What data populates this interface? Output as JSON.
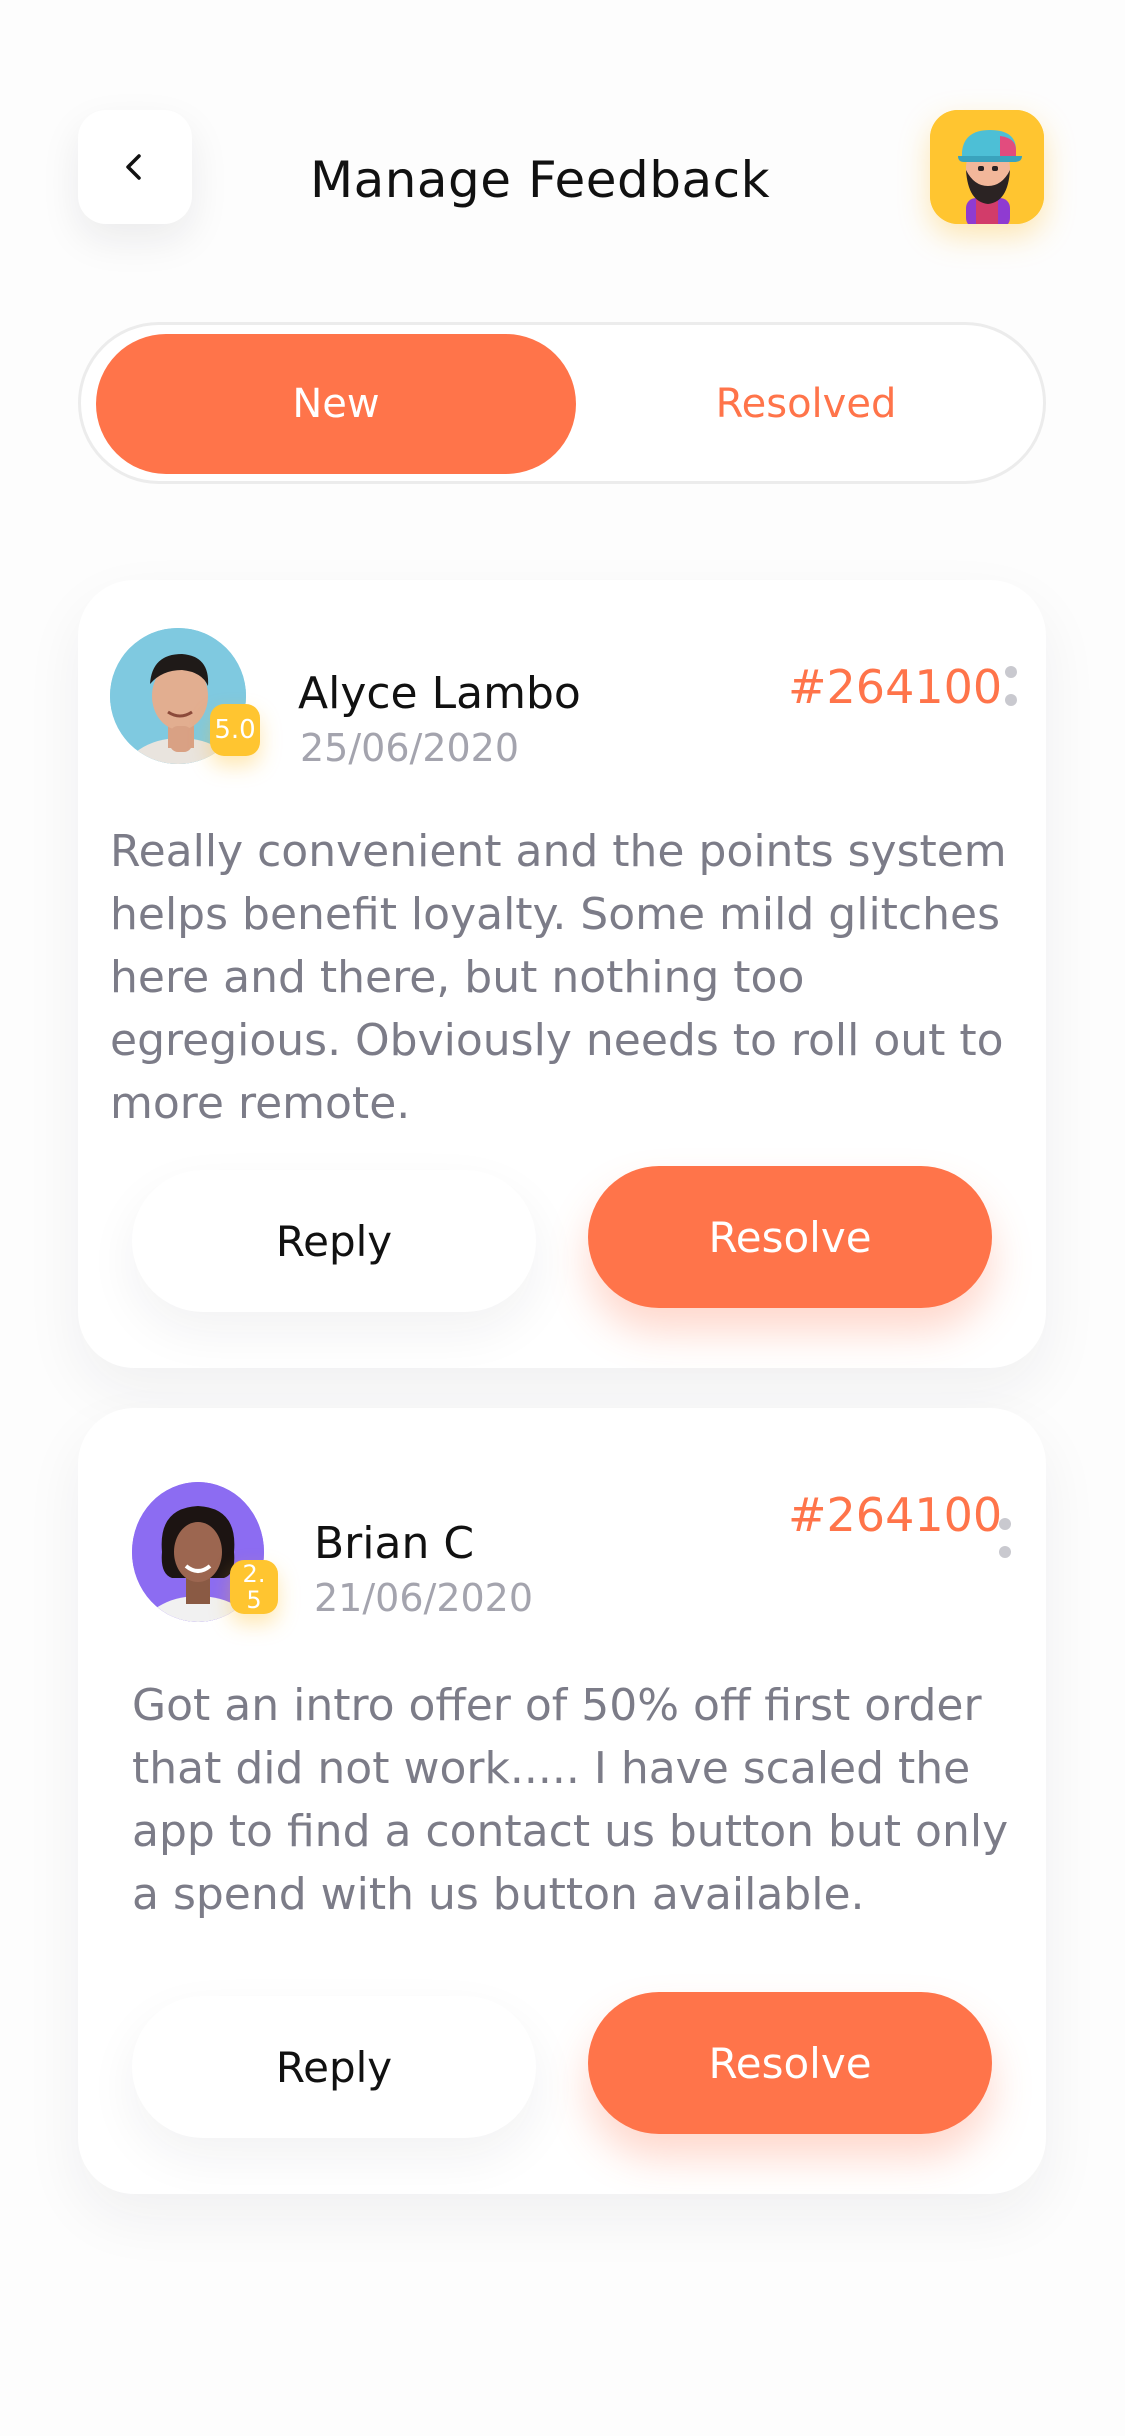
{
  "header": {
    "title": "Manage Feedback",
    "back_icon": "chevron-left-icon",
    "profile_avatar": "bearded-man-avatar"
  },
  "tabs": [
    {
      "label": "New",
      "active": true
    },
    {
      "label": "Resolved",
      "active": false
    }
  ],
  "feedback": [
    {
      "name": "Alyce Lambo",
      "date": "25/06/2020",
      "rating": "5.0",
      "ticket": "#264100",
      "comment": "Really convenient and the points system helps benefit loyalty. Some mild glitches here and there, but nothing too egregious. Obviously needs to roll out to more remote.",
      "reply_label": "Reply",
      "resolve_label": "Resolve"
    },
    {
      "name": "Brian C",
      "date": "21/06/2020",
      "rating": "2.5",
      "ticket": "#264100",
      "comment": "Got an intro offer of 50% off first order that did not work..... I have scaled the app to find a contact us button but only a spend with us button available.",
      "reply_label": "Reply",
      "resolve_label": "Resolve"
    }
  ],
  "colors": {
    "accent": "#ff744a",
    "badge": "#ffc530",
    "muted_text": "#7c7c88",
    "date_text": "#a4a4ae"
  }
}
